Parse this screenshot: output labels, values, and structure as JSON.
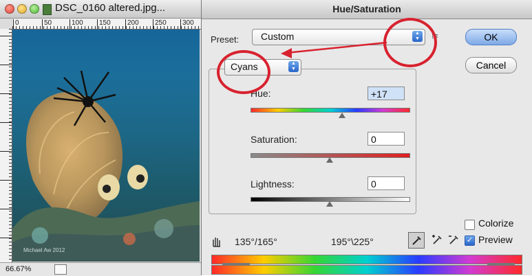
{
  "document": {
    "title": "DSC_0160 altered.jpg...",
    "ruler_top_labels": [
      "0",
      "50",
      "100",
      "150",
      "200",
      "250",
      "300"
    ],
    "zoom": "66.67%",
    "photo_credit": "Michael Aw 2012"
  },
  "dialog": {
    "title": "Hue/Saturation",
    "preset_label": "Preset:",
    "preset_value": "Custom",
    "ok_label": "OK",
    "cancel_label": "Cancel",
    "edit_value": "Cyans",
    "hue_label": "Hue:",
    "hue_value": "+17",
    "saturation_label": "Saturation:",
    "saturation_value": "0",
    "lightness_label": "Lightness:",
    "lightness_value": "0",
    "range_left": "135°/165°",
    "range_right": "195°\\225°",
    "colorize_label": "Colorize",
    "preview_label": "Preview",
    "colorize_checked": false,
    "preview_checked": true
  },
  "annotation_color": "#d8222f"
}
